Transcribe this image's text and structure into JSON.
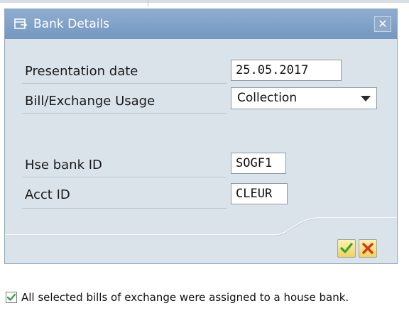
{
  "dialog": {
    "title": "Bank Details",
    "close_label": "✕"
  },
  "form": {
    "presentation_date": {
      "label": "Presentation date",
      "value": "25.05.2017"
    },
    "bill_exchange_usage": {
      "label": "Bill/Exchange Usage",
      "value": "Collection"
    },
    "hse_bank_id": {
      "label": "Hse bank ID",
      "value": "SOGF1"
    },
    "acct_id": {
      "label": "Acct ID",
      "value": "CLEUR"
    }
  },
  "buttons": {
    "ok_icon": "checkmark-icon",
    "cancel_icon": "cross-icon"
  },
  "status": {
    "icon": "success-check-icon",
    "message": "All selected bills of exchange were assigned to a house bank."
  },
  "colors": {
    "titlebar": "#7f9fc7",
    "dialog_bg": "#dbe3ea",
    "ok_green": "#3aa33a",
    "cancel_red": "#d23a1e"
  }
}
